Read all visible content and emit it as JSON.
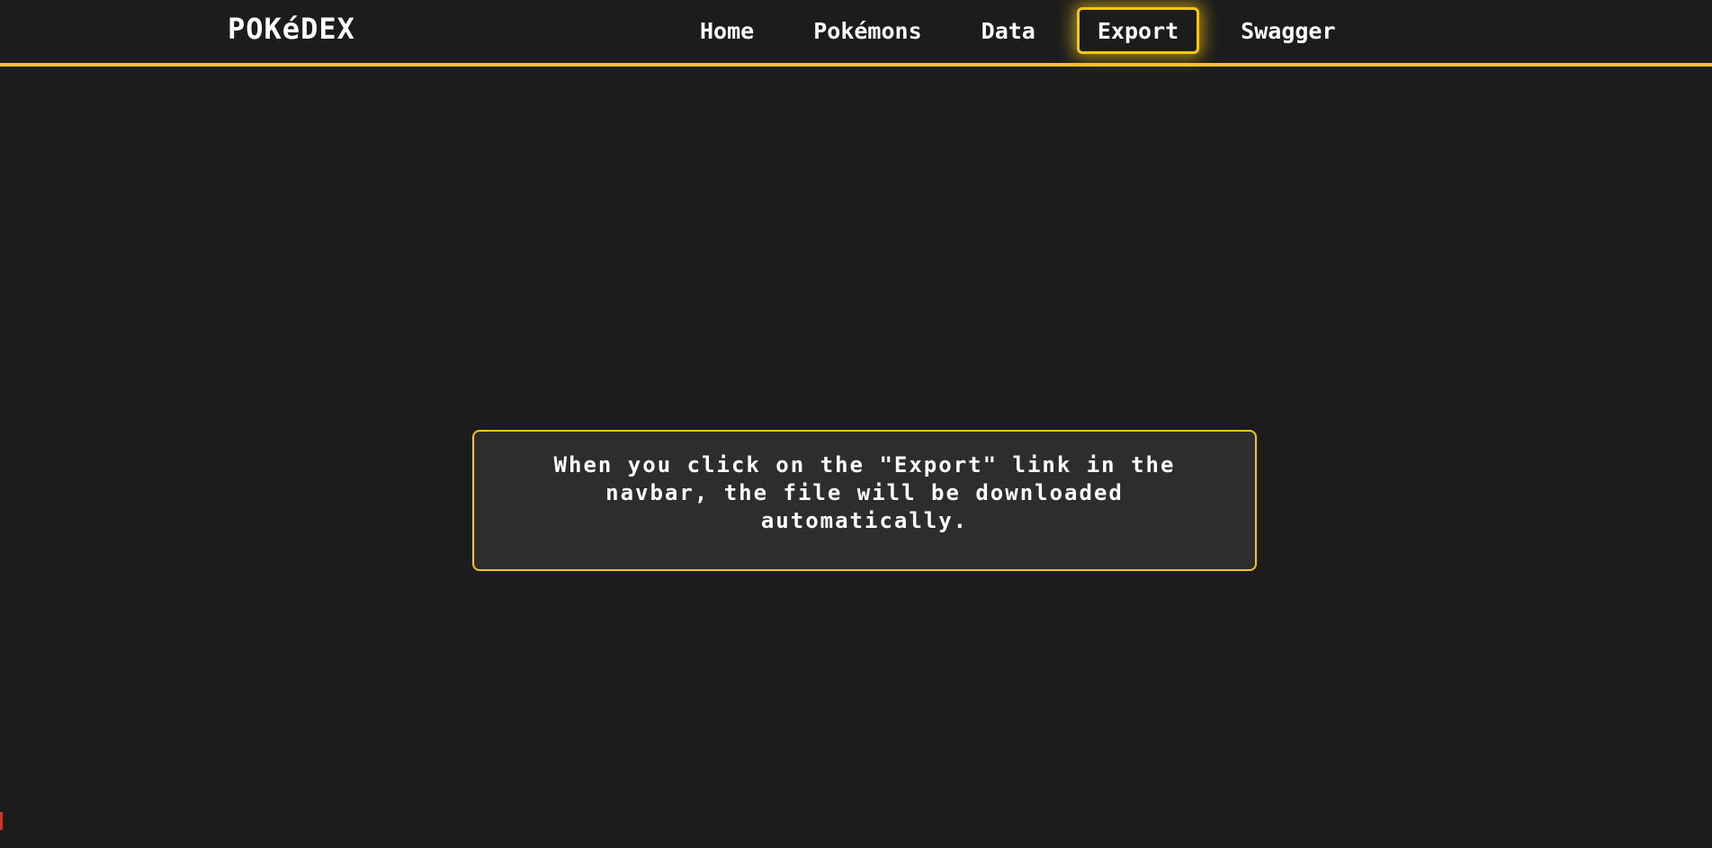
{
  "app": {
    "logo_text": "POKéDEX"
  },
  "nav": {
    "items": [
      {
        "label": "Home",
        "active": false
      },
      {
        "label": "Pokémons",
        "active": false
      },
      {
        "label": "Data",
        "active": false
      },
      {
        "label": "Export",
        "active": true
      },
      {
        "label": "Swagger",
        "active": false
      }
    ]
  },
  "main": {
    "message": "When you click on the \"Export\" link in the navbar, the file will be downloaded automatically."
  },
  "colors": {
    "background": "#1c1c1c",
    "accent": "#f5c518",
    "box_background": "#2d2d2d",
    "text": "#ffffff"
  }
}
